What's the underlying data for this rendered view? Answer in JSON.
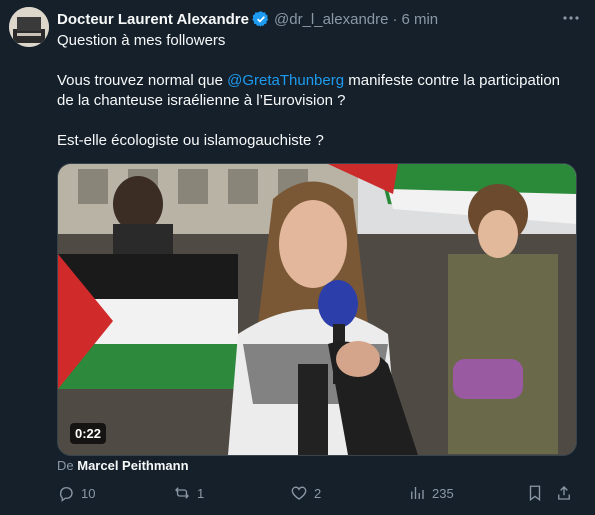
{
  "author": {
    "name": "Docteur Laurent Alexandre",
    "handle": "@dr_l_alexandre",
    "separator": "·",
    "time": "6 min"
  },
  "tweet": {
    "line1": "Question à mes followers",
    "p2_before": "Vous trouvez normal que ",
    "mention": "@GretaThunberg",
    "p2_after": " manifeste contre la participation de la chanteuse israélienne à l’Eurovision ?",
    "line3": "Est-elle écologiste ou islamogauchiste ?"
  },
  "video": {
    "duration": "0:22"
  },
  "attribution": {
    "prefix": "De",
    "source": "Marcel Peithmann"
  },
  "actions": {
    "replies": "10",
    "reposts": "1",
    "likes": "2",
    "views": "235"
  },
  "colors": {
    "background": "#15202b",
    "accent": "#1d9bf0",
    "muted": "#8b98a5"
  },
  "icons": [
    "verified-badge-icon",
    "more-icon",
    "reply-icon",
    "repost-icon",
    "like-icon",
    "views-icon",
    "bookmark-icon",
    "share-icon"
  ]
}
